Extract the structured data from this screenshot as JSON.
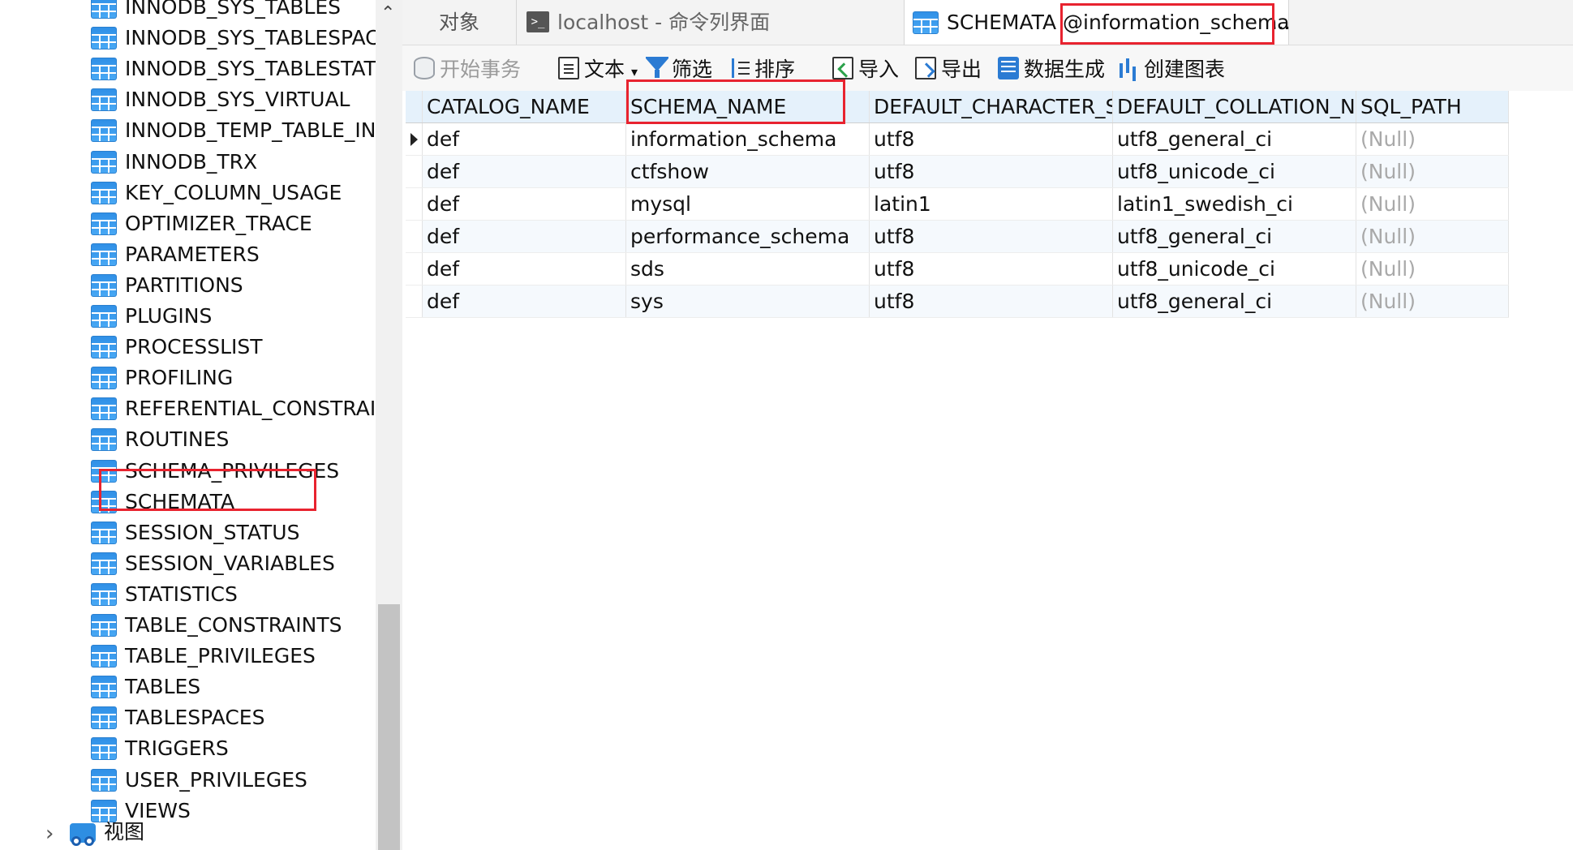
{
  "sidebar": {
    "items": [
      {
        "label": "INNODB_SYS_TABLES"
      },
      {
        "label": "INNODB_SYS_TABLESPACES"
      },
      {
        "label": "INNODB_SYS_TABLESTATS"
      },
      {
        "label": "INNODB_SYS_VIRTUAL"
      },
      {
        "label": "INNODB_TEMP_TABLE_INFO"
      },
      {
        "label": "INNODB_TRX"
      },
      {
        "label": "KEY_COLUMN_USAGE"
      },
      {
        "label": "OPTIMIZER_TRACE"
      },
      {
        "label": "PARAMETERS"
      },
      {
        "label": "PARTITIONS"
      },
      {
        "label": "PLUGINS"
      },
      {
        "label": "PROCESSLIST"
      },
      {
        "label": "PROFILING"
      },
      {
        "label": "REFERENTIAL_CONSTRAINTS"
      },
      {
        "label": "ROUTINES"
      },
      {
        "label": "SCHEMA_PRIVILEGES"
      },
      {
        "label": "SCHEMATA",
        "highlighted": true
      },
      {
        "label": "SESSION_STATUS"
      },
      {
        "label": "SESSION_VARIABLES"
      },
      {
        "label": "STATISTICS"
      },
      {
        "label": "TABLE_CONSTRAINTS"
      },
      {
        "label": "TABLE_PRIVILEGES"
      },
      {
        "label": "TABLES"
      },
      {
        "label": "TABLESPACES"
      },
      {
        "label": "TRIGGERS"
      },
      {
        "label": "USER_PRIVILEGES"
      },
      {
        "label": "VIEWS"
      }
    ],
    "views_label": "视图"
  },
  "tabs": {
    "objects": "对象",
    "console_icon": ">_",
    "console": "localhost - 命令列界面",
    "active_table": "SCHEMATA",
    "active_db": "@information_schema",
    "active_ellipsis": "..."
  },
  "toolbar": {
    "begin_transaction": "开始事务",
    "text": "文本",
    "text_dropdown": "▾",
    "filter": "筛选",
    "sort": "排序",
    "import": "导入",
    "export": "导出",
    "generate_data": "数据生成",
    "create_chart": "创建图表"
  },
  "grid": {
    "columns": [
      "CATALOG_NAME",
      "SCHEMA_NAME",
      "DEFAULT_CHARACTER_SET_NAME",
      "DEFAULT_COLLATION_NAME",
      "SQL_PATH"
    ],
    "rows": [
      [
        "def",
        "information_schema",
        "utf8",
        "utf8_general_ci",
        "(Null)"
      ],
      [
        "def",
        "ctfshow",
        "utf8",
        "utf8_unicode_ci",
        "(Null)"
      ],
      [
        "def",
        "mysql",
        "latin1",
        "latin1_swedish_ci",
        "(Null)"
      ],
      [
        "def",
        "performance_schema",
        "utf8",
        "utf8_general_ci",
        "(Null)"
      ],
      [
        "def",
        "sds",
        "utf8",
        "utf8_unicode_ci",
        "(Null)"
      ],
      [
        "def",
        "sys",
        "utf8",
        "utf8_general_ci",
        "(Null)"
      ]
    ]
  },
  "colors": {
    "highlight": "#e8232f",
    "header_bg": "#e5f1fb",
    "null_text": "#a9a9a9",
    "accent": "#2b7bd3"
  },
  "icons": {
    "table": "table-icon",
    "views": "views-icon",
    "command_line": "command-line-icon",
    "begin_transaction": "database-icon",
    "text": "text-view-icon",
    "filter": "filter-icon",
    "sort": "sort-icon",
    "import": "import-icon",
    "export": "export-icon",
    "generate_data": "data-generation-icon",
    "create_chart": "chart-icon"
  }
}
